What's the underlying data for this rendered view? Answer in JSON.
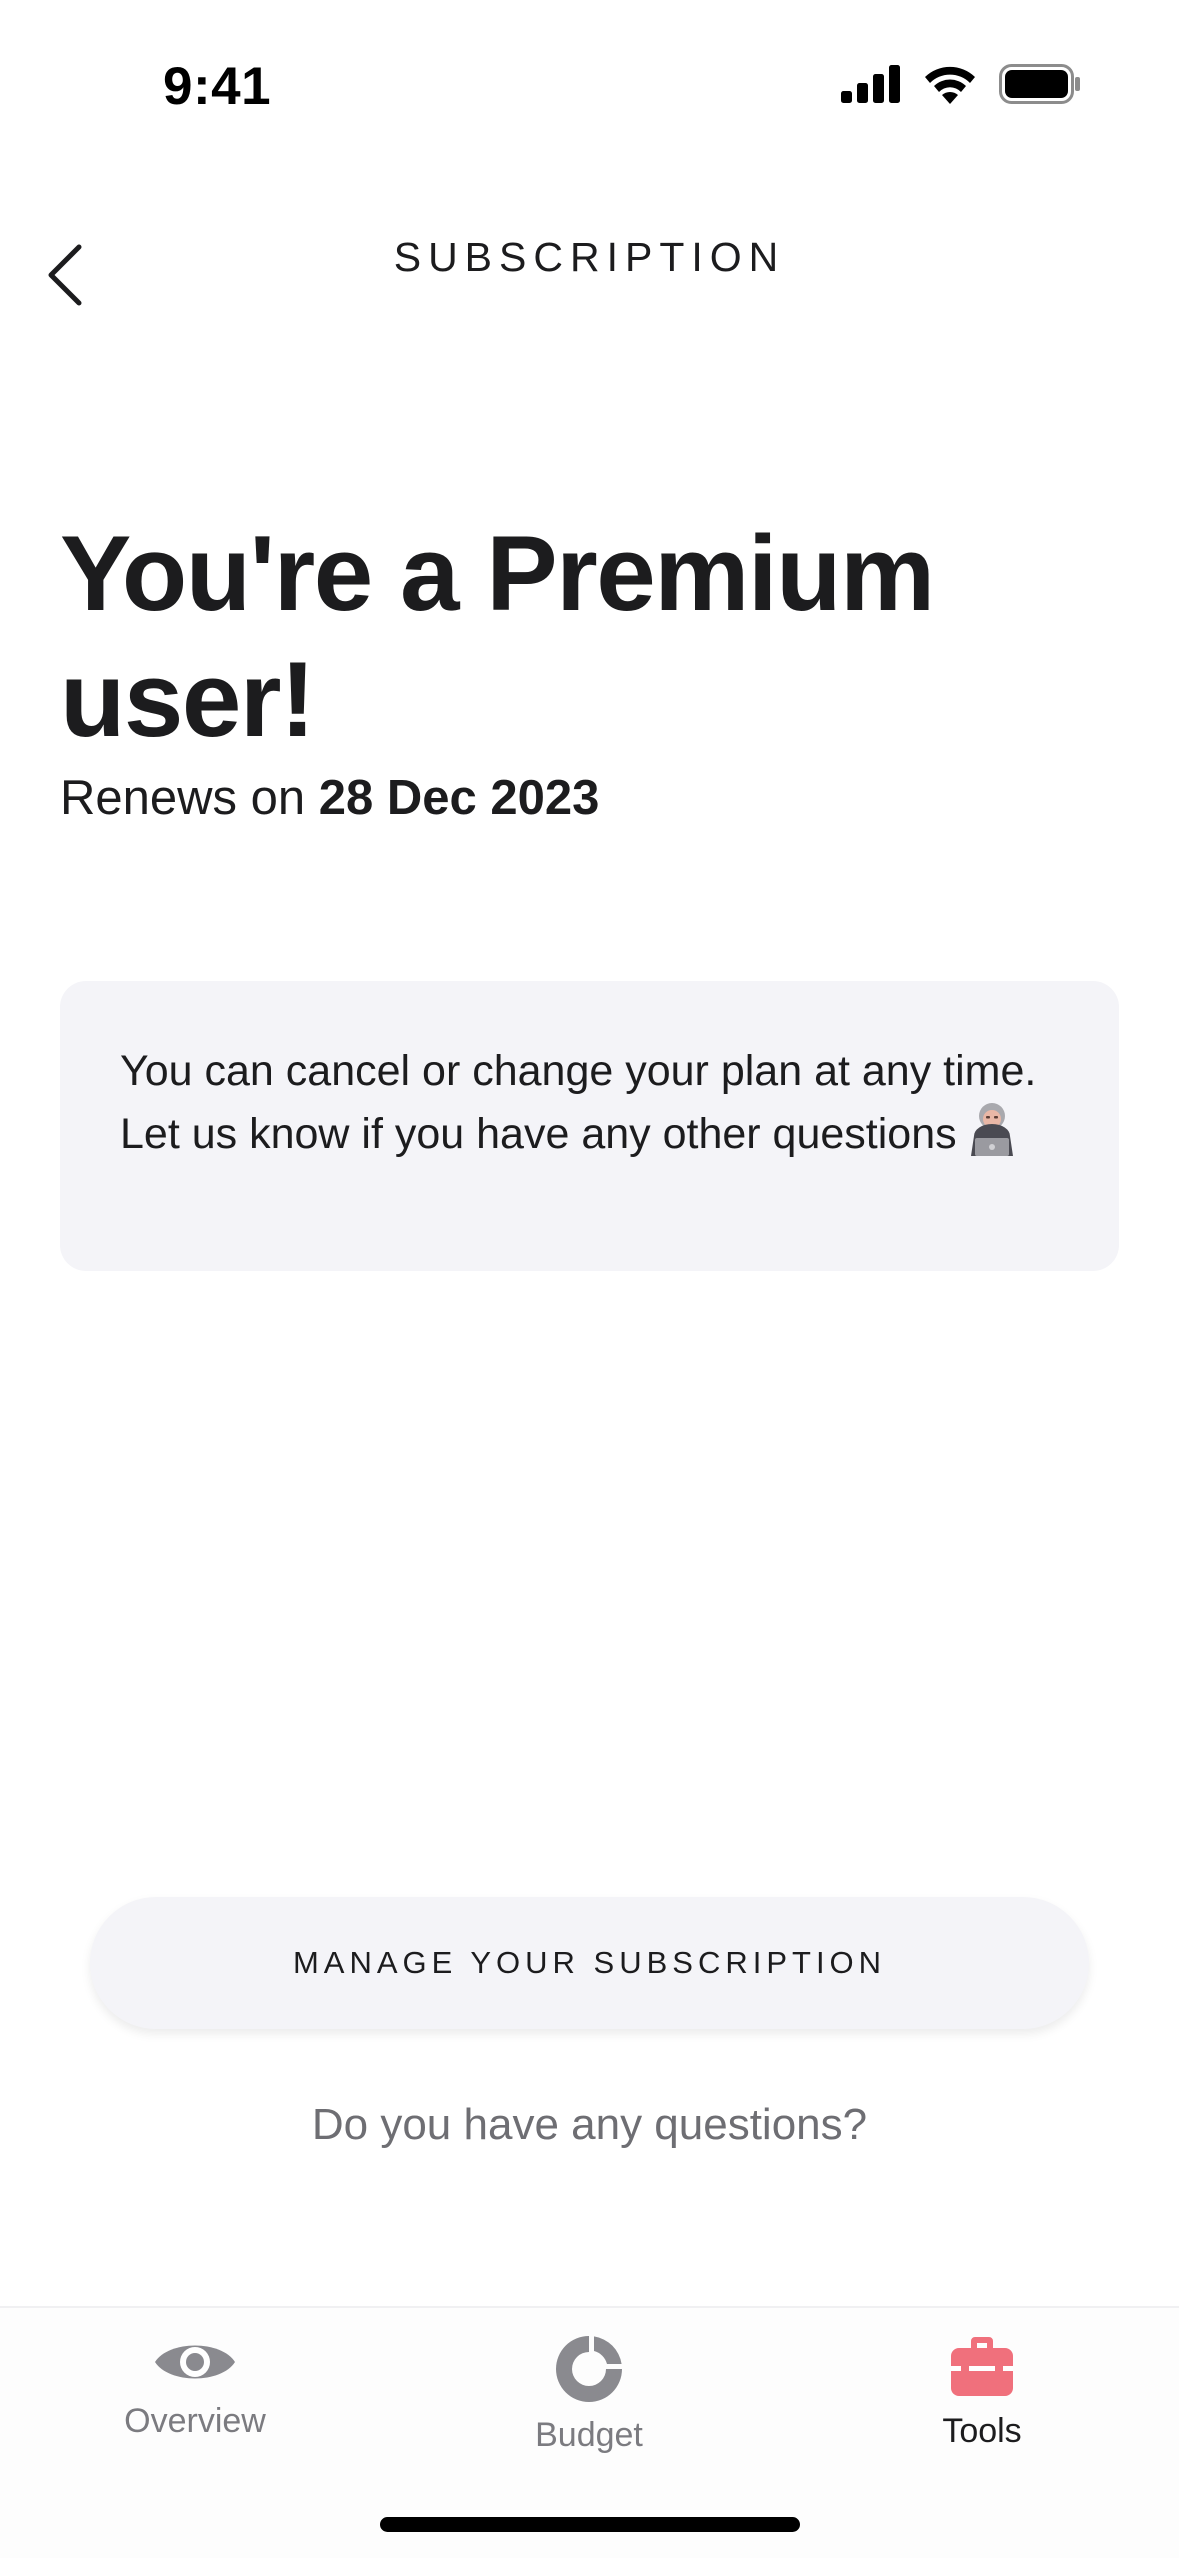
{
  "status_bar": {
    "time": "9:41"
  },
  "header": {
    "title": "SUBSCRIPTION"
  },
  "hero": {
    "title": "You're a Premium user!",
    "renew_prefix": "Renews on ",
    "renew_date": "28 Dec 2023"
  },
  "info_card": {
    "text": "You can cancel or change your plan at any time. Let us know if you have any other questions"
  },
  "actions": {
    "manage_label": "MANAGE YOUR SUBSCRIPTION",
    "questions_label": "Do you have any questions?"
  },
  "tab_bar": {
    "items": [
      {
        "label": "Overview",
        "icon": "eye-icon",
        "active": false
      },
      {
        "label": "Budget",
        "icon": "donut-chart-icon",
        "active": false
      },
      {
        "label": "Tools",
        "icon": "toolbox-icon",
        "active": true
      }
    ]
  },
  "colors": {
    "accent": "#f0707c",
    "card_background": "#f4f4f8",
    "text_primary": "#1c1c1e",
    "text_secondary": "#6e6e73",
    "tab_inactive": "#7b7b80"
  }
}
